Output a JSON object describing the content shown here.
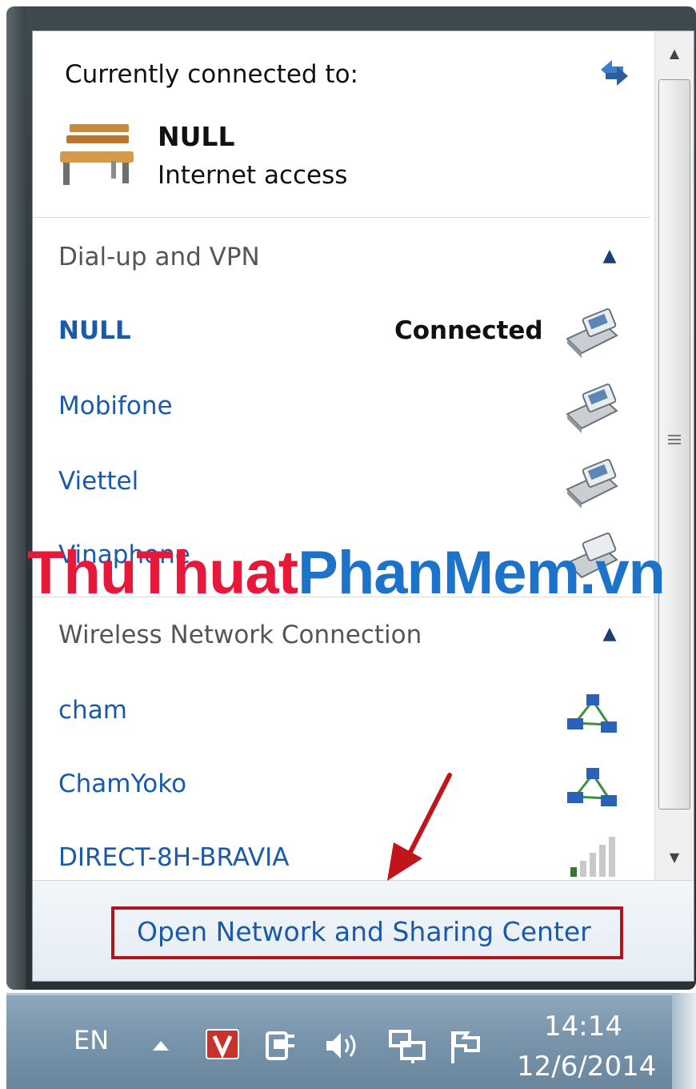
{
  "flyout": {
    "current_header": "Currently connected to:",
    "current_connection": {
      "name": "NULL",
      "status": "Internet access",
      "icon": "bench-icon"
    },
    "refresh_icon": "refresh-icon",
    "sections": [
      {
        "title": "Dial-up and VPN",
        "items": [
          {
            "name": "NULL",
            "status": "Connected",
            "icon": "dialup-phone-icon"
          },
          {
            "name": "Mobifone",
            "status": "",
            "icon": "dialup-phone-icon"
          },
          {
            "name": "Viettel",
            "status": "",
            "icon": "dialup-phone-icon"
          },
          {
            "name": "Vinaphone",
            "status": "",
            "icon": "dialup-phone-icon"
          }
        ]
      },
      {
        "title": "Wireless Network Connection",
        "items": [
          {
            "name": "cham",
            "icon": "adhoc-network-icon"
          },
          {
            "name": "ChamYoko",
            "icon": "adhoc-network-icon"
          },
          {
            "name": "DIRECT-8H-BRAVIA",
            "icon": "signal-bars-icon"
          }
        ]
      }
    ],
    "footer_link": "Open Network and Sharing Center"
  },
  "watermark": {
    "part1": "ThuThuat",
    "part2": "PhanMem.vn"
  },
  "taskbar": {
    "language": "EN",
    "tray_icons": [
      "show-hidden-icons-icon",
      "v-app-icon",
      "power-icon",
      "volume-icon",
      "network-icon",
      "action-center-flag-icon"
    ],
    "time": "14:14",
    "date": "12/6/2014"
  },
  "colors": {
    "link": "#1a5aa8",
    "highlight_box": "#b0151c",
    "arrow": "#c0151c",
    "taskbar": "#7894aa"
  }
}
